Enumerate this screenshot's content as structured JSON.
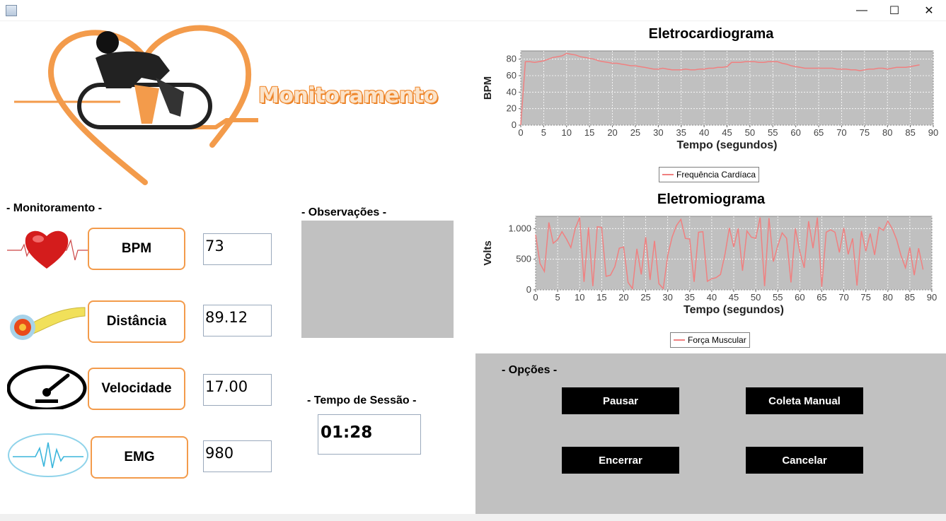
{
  "window": {
    "minimize": "—",
    "maximize": "☐",
    "close": "✕"
  },
  "logo": {
    "title": "Monitoramento"
  },
  "monitoring": {
    "section_title": "- Monitoramento -",
    "metrics": [
      {
        "label": "BPM",
        "value": "73",
        "icon": "heart-pulse-icon"
      },
      {
        "label": "Distância",
        "value": "89.12",
        "icon": "measuring-tape-icon"
      },
      {
        "label": "Velocidade",
        "value": "17.00",
        "icon": "speedometer-icon"
      },
      {
        "label": "EMG",
        "value": "980",
        "icon": "emg-wave-icon"
      }
    ]
  },
  "observations": {
    "title": "- Observações -"
  },
  "session": {
    "title": "- Tempo de Sessão -",
    "time": "01:28"
  },
  "options": {
    "title": "- Opções -",
    "pause": "Pausar",
    "manual": "Coleta Manual",
    "finish": "Encerrar",
    "cancel": "Cancelar"
  },
  "colors": {
    "accent": "#f39b4b",
    "series": "#f08080",
    "plot_bg": "#c0c0c0",
    "panel": "#c1c1c1"
  },
  "chart_data": [
    {
      "type": "line",
      "title": "Eletrocardiograma",
      "xlabel": "Tempo (segundos)",
      "ylabel": "BPM",
      "xlim": [
        0,
        90
      ],
      "ylim": [
        0,
        90
      ],
      "xticks": [
        "0",
        "5",
        "10",
        "15",
        "20",
        "25",
        "30",
        "35",
        "40",
        "45",
        "50",
        "55",
        "60",
        "65",
        "70",
        "75",
        "80",
        "85",
        "90"
      ],
      "yticks": [
        "0",
        "20",
        "40",
        "60",
        "80"
      ],
      "series": [
        {
          "name": "Frequência Cardíaca",
          "x": [
            0,
            1,
            2,
            3,
            4,
            5,
            6,
            7,
            8,
            9,
            10,
            11,
            12,
            13,
            14,
            15,
            16,
            17,
            18,
            19,
            20,
            21,
            22,
            23,
            24,
            25,
            26,
            27,
            28,
            29,
            30,
            31,
            32,
            33,
            34,
            35,
            36,
            37,
            38,
            39,
            40,
            41,
            42,
            43,
            44,
            45,
            46,
            47,
            48,
            49,
            50,
            51,
            52,
            53,
            54,
            55,
            56,
            57,
            58,
            59,
            60,
            61,
            62,
            63,
            64,
            65,
            66,
            67,
            68,
            69,
            70,
            71,
            72,
            73,
            74,
            75,
            76,
            77,
            78,
            79,
            80,
            81,
            82,
            83,
            84,
            85,
            86,
            87
          ],
          "y": [
            0,
            77,
            77,
            76,
            77,
            78,
            80,
            82,
            83,
            84,
            87,
            86,
            85,
            83,
            82,
            81,
            80,
            78,
            77,
            76,
            75,
            75,
            74,
            73,
            72,
            72,
            71,
            70,
            69,
            68,
            68,
            69,
            68,
            67,
            67,
            67,
            68,
            67,
            67,
            68,
            68,
            69,
            69,
            70,
            70,
            71,
            76,
            76,
            76,
            77,
            77,
            77,
            76,
            76,
            77,
            77,
            77,
            75,
            74,
            72,
            71,
            70,
            69,
            69,
            69,
            69,
            69,
            69,
            69,
            68,
            68,
            68,
            67,
            67,
            66,
            67,
            68,
            68,
            69,
            69,
            68,
            69,
            70,
            70,
            70,
            71,
            72,
            73
          ]
        }
      ]
    },
    {
      "type": "line",
      "title": "Eletromiograma",
      "xlabel": "Tempo (segundos)",
      "ylabel": "Volts",
      "xlim": [
        0,
        90
      ],
      "ylim": [
        0,
        1200
      ],
      "xticks": [
        "0",
        "5",
        "10",
        "15",
        "20",
        "25",
        "30",
        "35",
        "40",
        "45",
        "50",
        "55",
        "60",
        "65",
        "70",
        "75",
        "80",
        "85",
        "90"
      ],
      "yticks": [
        "0",
        "500",
        "1.000"
      ],
      "series": [
        {
          "name": "Força Muscular",
          "x": [
            0,
            1,
            2,
            3,
            4,
            5,
            6,
            7,
            8,
            9,
            10,
            11,
            12,
            13,
            14,
            15,
            16,
            17,
            18,
            19,
            20,
            21,
            22,
            23,
            24,
            25,
            26,
            27,
            28,
            29,
            30,
            31,
            32,
            33,
            34,
            35,
            36,
            37,
            38,
            39,
            40,
            41,
            42,
            43,
            44,
            45,
            46,
            47,
            48,
            49,
            50,
            51,
            52,
            53,
            54,
            55,
            56,
            57,
            58,
            59,
            60,
            61,
            62,
            63,
            64,
            65,
            66,
            67,
            68,
            69,
            70,
            71,
            72,
            73,
            74,
            75,
            76,
            77,
            78,
            79,
            80,
            81,
            82,
            83,
            84,
            85,
            86,
            87,
            88
          ],
          "y": [
            900,
            430,
            300,
            1100,
            760,
            820,
            950,
            830,
            690,
            1000,
            1180,
            130,
            1020,
            60,
            1030,
            1020,
            220,
            240,
            380,
            680,
            700,
            120,
            20,
            670,
            250,
            860,
            160,
            800,
            100,
            20,
            560,
            860,
            1050,
            1150,
            840,
            830,
            130,
            940,
            950,
            140,
            180,
            200,
            250,
            580,
            1010,
            700,
            1000,
            310,
            960,
            860,
            840,
            1180,
            60,
            1170,
            460,
            720,
            930,
            840,
            120,
            1000,
            630,
            360,
            1120,
            680,
            1180,
            50,
            940,
            980,
            940,
            610,
            1010,
            580,
            840,
            70,
            960,
            630,
            920,
            570,
            1020,
            970,
            1120,
            1000,
            820,
            560,
            360,
            690,
            240,
            680,
            330
          ]
        }
      ]
    }
  ]
}
